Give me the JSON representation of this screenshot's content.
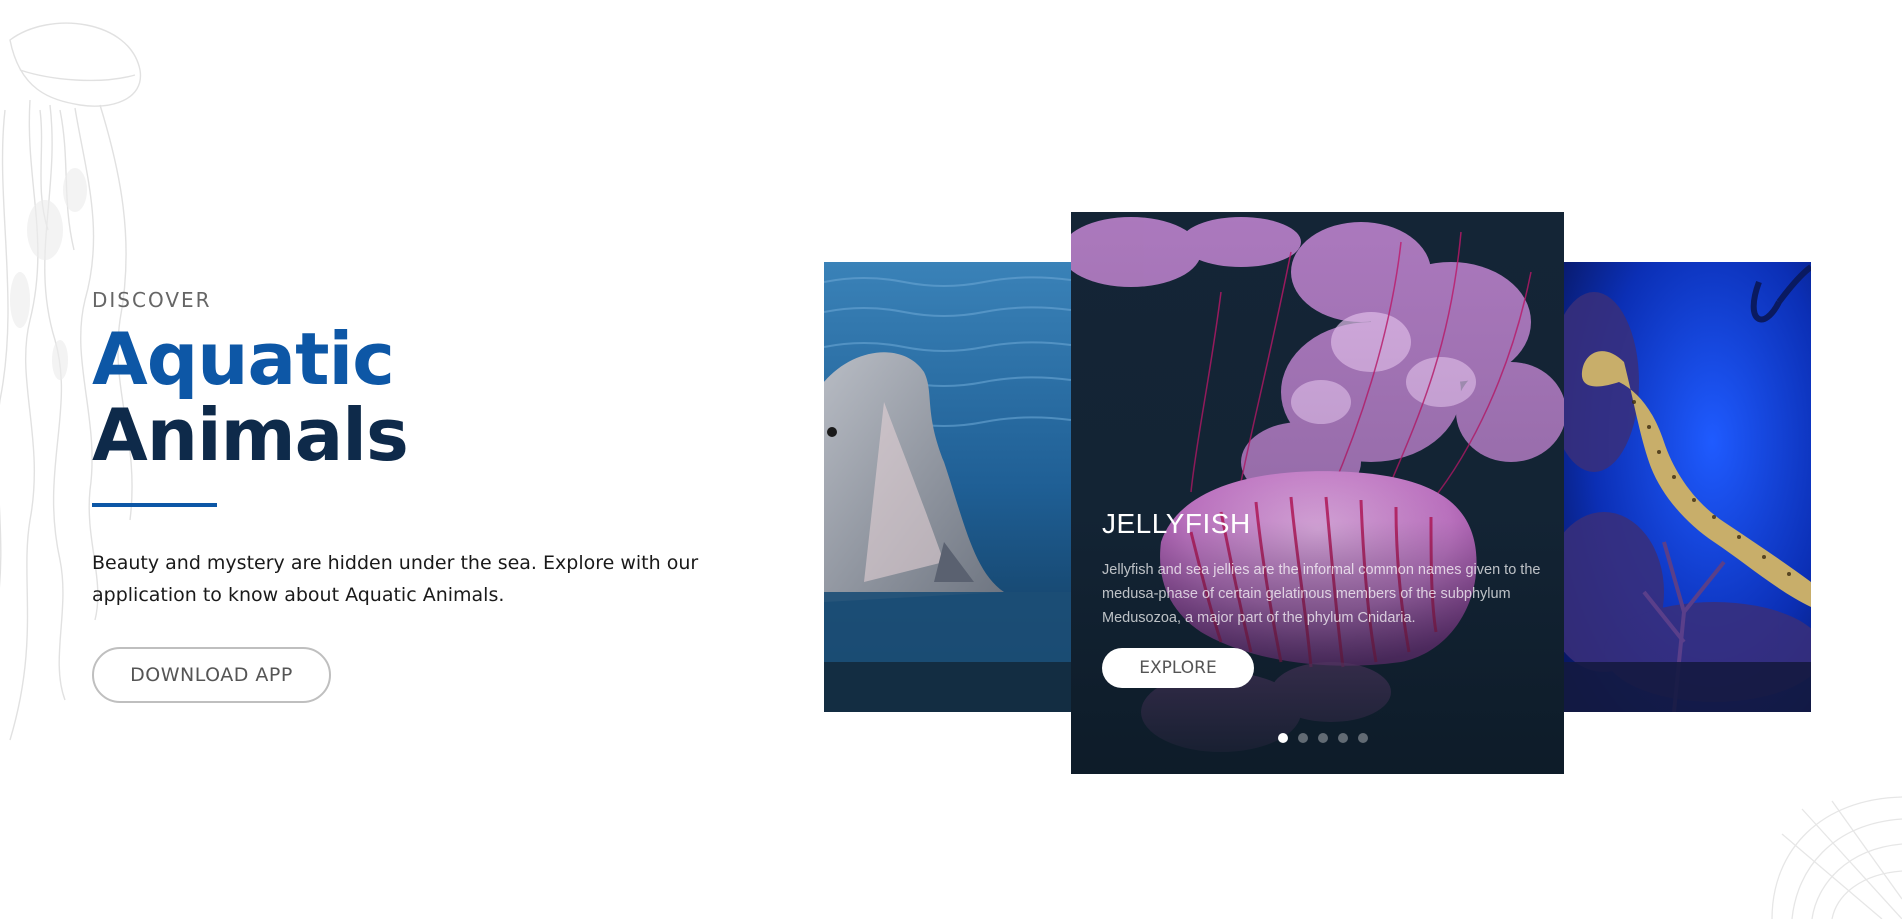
{
  "hero": {
    "eyebrow": "DISCOVER",
    "title_part1": "Aquatic",
    "title_part2": "Animals",
    "description": "Beauty and mystery are hidden under the sea. Explore with our application to know about Aquatic Animals.",
    "download_label": "DOWNLOAD APP"
  },
  "slider": {
    "active_card": {
      "title": "JELLYFISH",
      "text": "Jellyfish and sea jellies are the informal common names given to the medusa-phase of certain gelatinous members of the subphylum Medusozoa, a major part of the phylum Cnidaria.",
      "explore_label": "EXPLORE"
    },
    "left_card_image": "dolphin",
    "right_card_image": "seahorse",
    "dots_count": 5,
    "active_dot": 1
  },
  "colors": {
    "accent": "#0d57a6",
    "title_dark": "#0e2a4a"
  },
  "icons": [
    "jellyfish-line-art",
    "shell-line-art"
  ]
}
